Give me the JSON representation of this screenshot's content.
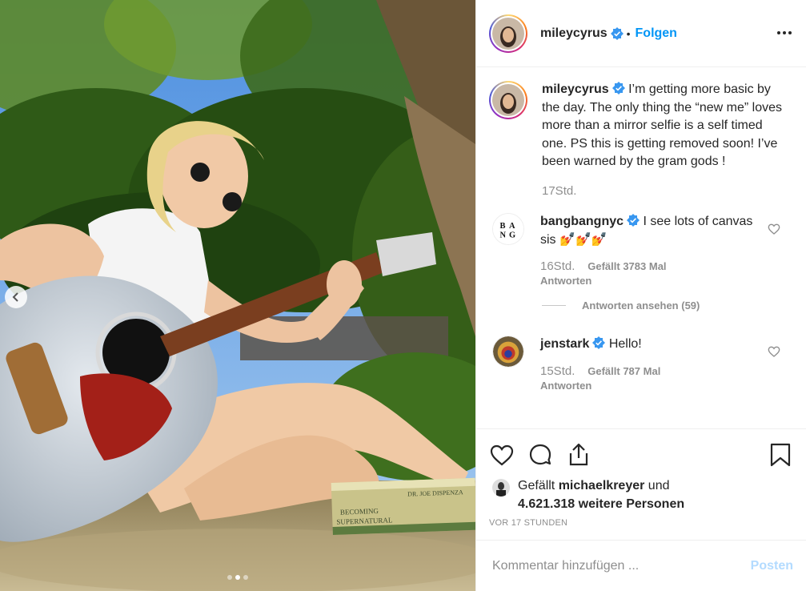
{
  "post": {
    "username": "mileycyrus",
    "follow_separator": "•",
    "follow_label": "Folgen",
    "caption": "I’m getting more basic by the day. The only thing the “new me” loves more than a mirror selfie is a self timed one. PS this is getting removed soon! I’ve been warned by the gram gods !",
    "caption_time": "17Std.",
    "liked_by_prefix": "Gefällt",
    "liked_by_user": "michaelkreyer",
    "liked_by_conj": "und",
    "liked_by_others": "4.621.318 weitere Personen",
    "timestamp": "VOR 17 STUNDEN"
  },
  "comments": [
    {
      "username": "bangbangnyc",
      "text": "I see lots of canvas sis",
      "emoji": "💅💅💅",
      "time": "16Std.",
      "likes": "Gefällt 3783 Mal",
      "reply": "Antworten",
      "view_replies": "Antworten ansehen (59)"
    },
    {
      "username": "jenstark",
      "text": "Hello!",
      "time": "15Std.",
      "likes": "Gefällt 787 Mal",
      "reply": "Antworten"
    }
  ],
  "composer": {
    "placeholder": "Kommentar hinzufügen ...",
    "post_label": "Posten"
  },
  "photo_book": {
    "title_line1": "BECOMING",
    "title_line2": "SUPERNATURAL",
    "author": "DR. JOE DISPENZA"
  },
  "icons": {
    "more": "more-options-icon",
    "verified": "verified-badge-icon",
    "heart": "heart-icon",
    "comment": "comment-icon",
    "share": "share-icon",
    "save": "bookmark-icon",
    "prev": "chevron-left-icon"
  },
  "colors": {
    "accent": "#0095f6",
    "post_disabled": "#b3dbff",
    "muted": "#8e8e8e",
    "text": "#262626"
  },
  "carousel": {
    "slides": 3,
    "active": 2
  }
}
